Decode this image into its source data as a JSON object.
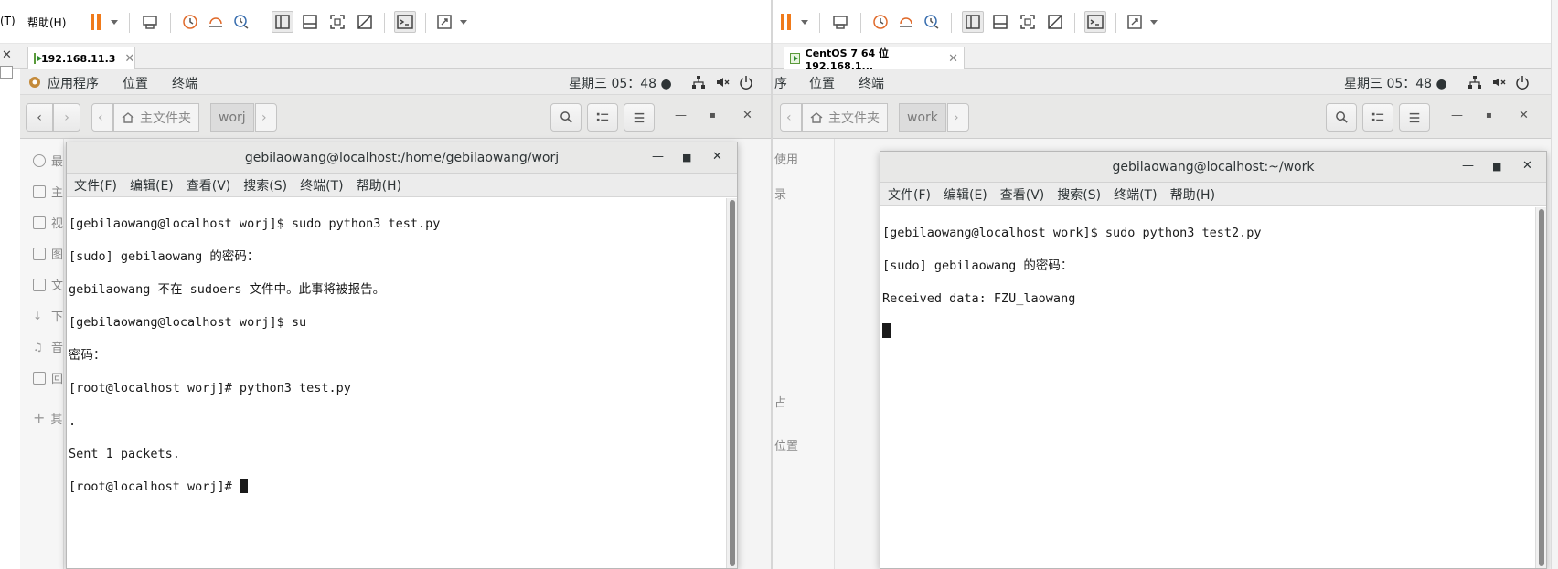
{
  "left": {
    "menu_fragment": "(T)",
    "help_menu": "帮助(H)",
    "tab_title": "192.168.11.3",
    "tab_close": "✕",
    "gnome": {
      "apps": "应用程序",
      "places": "位置",
      "terminal": "终端",
      "clock": "星期三 05：48 ●"
    },
    "nautilus": {
      "home_crumb": "主文件夹",
      "folder_crumb": "worj"
    },
    "sidebar": [
      "最",
      "主",
      "视",
      "图",
      "文",
      "下",
      "音",
      "回",
      "其"
    ],
    "terminal": {
      "title": "gebilaowang@localhost:/home/gebilaowang/worj",
      "menu": [
        "文件(F)",
        "编辑(E)",
        "查看(V)",
        "搜索(S)",
        "终端(T)",
        "帮助(H)"
      ],
      "lines": [
        "[gebilaowang@localhost worj]$ sudo python3 test.py",
        "[sudo] gebilaowang 的密码：",
        "gebilaowang 不在 sudoers 文件中。此事将被报告。",
        "[gebilaowang@localhost worj]$ su",
        "密码：",
        "[root@localhost worj]# python3 test.py",
        ".",
        "Sent 1 packets.",
        "[root@localhost worj]# "
      ]
    }
  },
  "right": {
    "tab_title": "CentOS 7 64 位 192.168.1...",
    "tab_close": "✕",
    "gnome": {
      "apps_fragment": "序",
      "places": "位置",
      "terminal": "终端",
      "clock": "星期三 05：48 ●"
    },
    "nautilus": {
      "home_crumb": "主文件夹",
      "folder_crumb": "work"
    },
    "sidebar": [
      "使用",
      "录",
      "占",
      "位置"
    ],
    "terminal": {
      "title": "gebilaowang@localhost:~/work",
      "menu": [
        "文件(F)",
        "编辑(E)",
        "查看(V)",
        "搜索(S)",
        "终端(T)",
        "帮助(H)"
      ],
      "lines": [
        "[gebilaowang@localhost work]$ sudo python3 test2.py",
        "[sudo] gebilaowang 的密码：",
        "Received data: FZU_laowang",
        ""
      ]
    }
  },
  "colors": {
    "pause": "#f07a1a",
    "gnome_bar": "#ececec",
    "header": "#e8e8e7"
  }
}
